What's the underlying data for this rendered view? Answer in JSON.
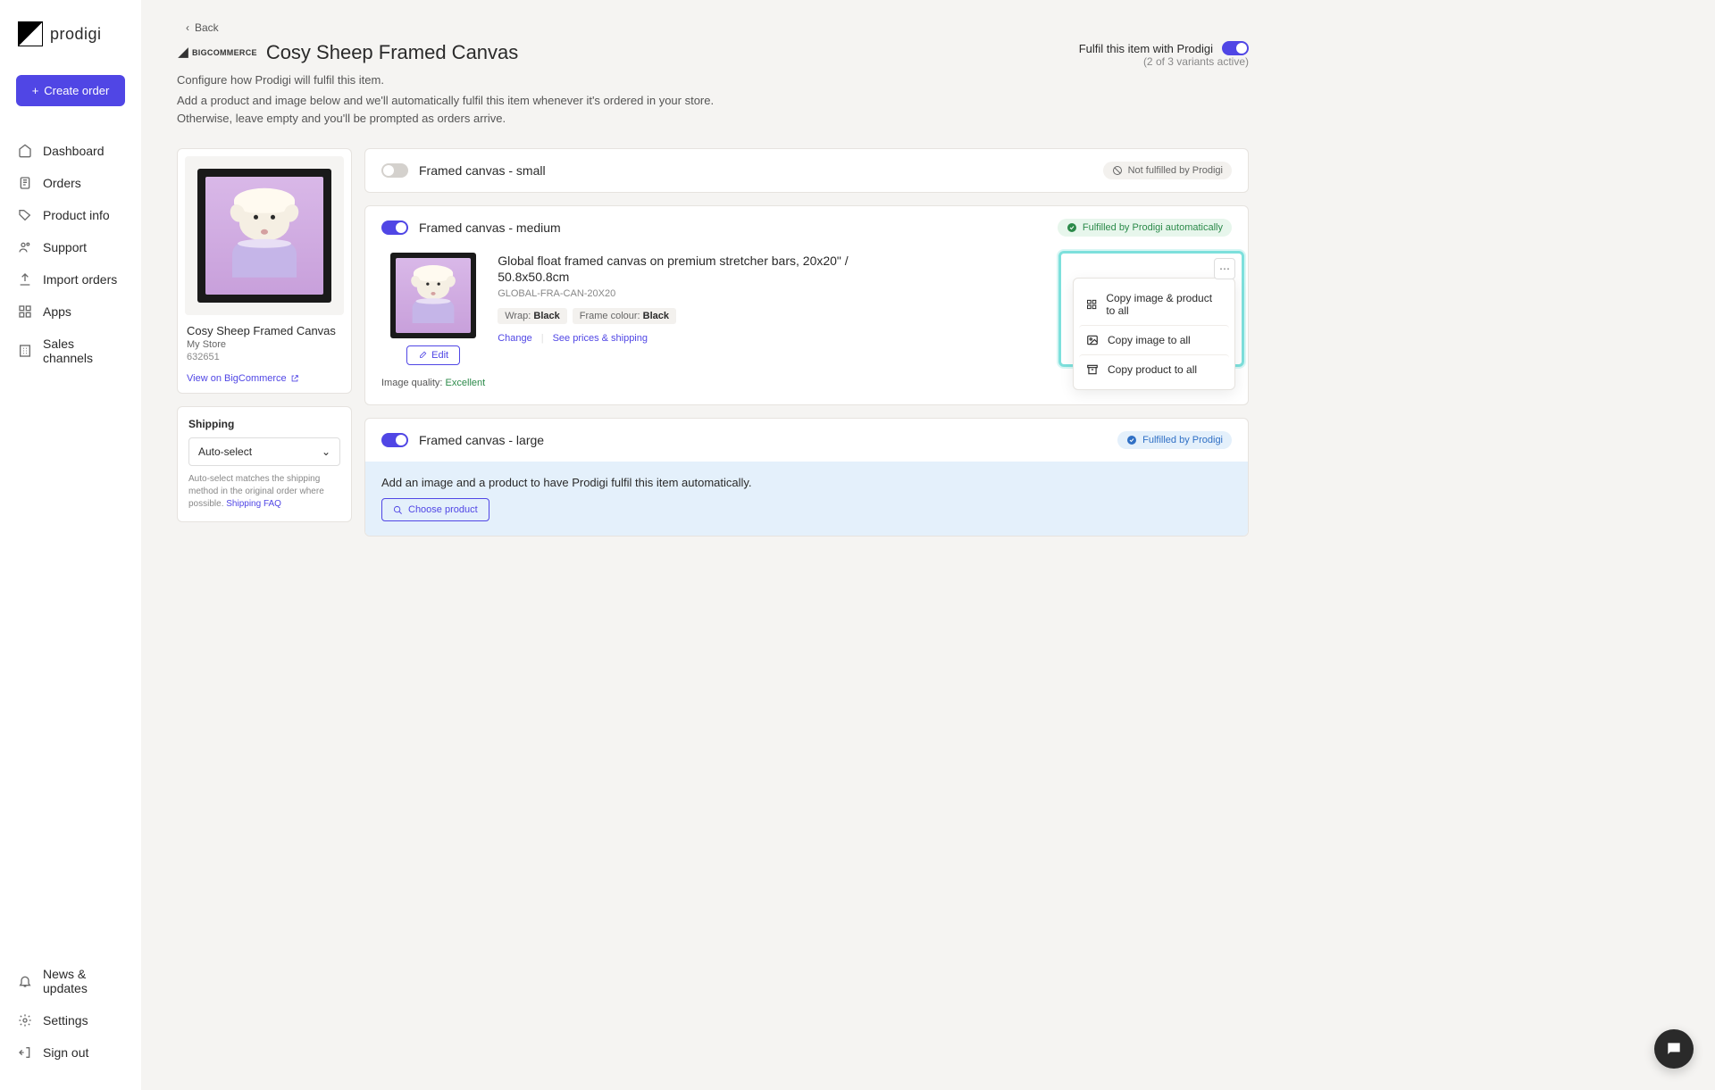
{
  "brand": "prodigi",
  "create_order_label": "Create order",
  "nav": {
    "items": [
      {
        "label": "Dashboard"
      },
      {
        "label": "Orders"
      },
      {
        "label": "Product info"
      },
      {
        "label": "Support"
      },
      {
        "label": "Import orders"
      },
      {
        "label": "Apps"
      },
      {
        "label": "Sales channels"
      }
    ],
    "bottom": [
      {
        "label": "News & updates"
      },
      {
        "label": "Settings"
      },
      {
        "label": "Sign out"
      }
    ]
  },
  "back_label": "Back",
  "platform_badge": "BIGCOMMERCE",
  "page_title": "Cosy Sheep Framed Canvas",
  "fulfil": {
    "label": "Fulfil this item with Prodigi",
    "sub": "(2 of 3 variants active)"
  },
  "subtitle": "Configure how Prodigi will fulfil this item.",
  "description": "Add a product and image below and we'll automatically fulfil this item whenever it's ordered in your store. Otherwise, leave empty and you'll be prompted as orders arrive.",
  "product": {
    "name": "Cosy Sheep Framed Canvas",
    "store": "My Store",
    "id": "632651",
    "view_link": "View on BigCommerce"
  },
  "shipping": {
    "label": "Shipping",
    "value": "Auto-select",
    "note_prefix": "Auto-select matches the shipping method in the original order where possible. ",
    "faq_label": "Shipping FAQ"
  },
  "variants": [
    {
      "name": "Framed canvas - small",
      "toggle": false,
      "status_label": "Not fulfilled by Prodigi"
    },
    {
      "name": "Framed canvas - medium",
      "toggle": true,
      "status_label": "Fulfilled by Prodigi automatically",
      "detail": {
        "product_name": "Global float framed canvas on premium stretcher bars, 20x20\" / 50.8x50.8cm",
        "sku": "GLOBAL-FRA-CAN-20X20",
        "attrs": [
          {
            "label": "Wrap:",
            "value": "Black"
          },
          {
            "label": "Frame colour:",
            "value": "Black"
          }
        ],
        "links": {
          "change": "Change",
          "prices": "See prices & shipping"
        },
        "edit_label": "Edit",
        "quality_label": "Image quality: ",
        "quality_value": "Excellent"
      },
      "menu": {
        "copy_both": "Copy image & product to all",
        "copy_image": "Copy image to all",
        "copy_product": "Copy product to all"
      }
    },
    {
      "name": "Framed canvas - large",
      "toggle": true,
      "status_label": "Fulfilled by Prodigi",
      "cta_msg": "Add an image and a product to have Prodigi fulfil this item automatically.",
      "choose_label": "Choose product"
    }
  ]
}
